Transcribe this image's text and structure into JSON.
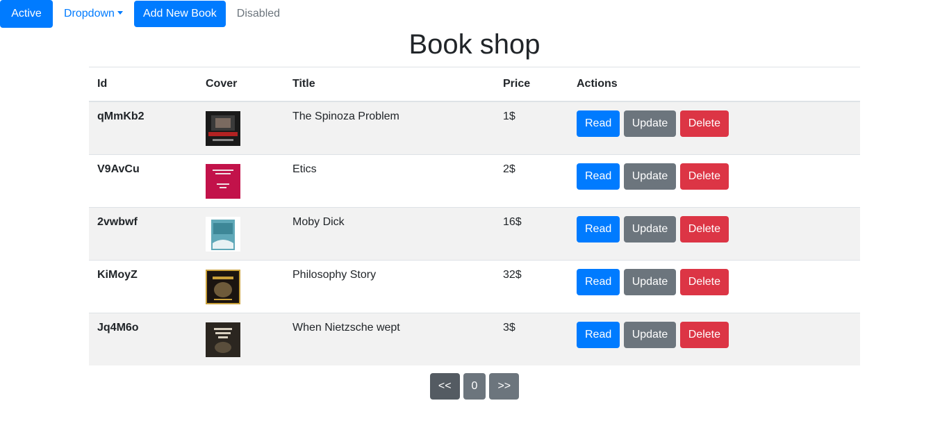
{
  "nav": {
    "active_label": "Active",
    "dropdown_label": "Dropdown",
    "add_label": "Add New Book",
    "disabled_label": "Disabled"
  },
  "page": {
    "title": "Book shop"
  },
  "table": {
    "headers": {
      "id": "Id",
      "cover": "Cover",
      "title": "Title",
      "price": "Price",
      "actions": "Actions"
    },
    "rows": [
      {
        "id": "qMmKb2",
        "title": "The Spinoza Problem",
        "price": "1$",
        "cover_colors": [
          "#1a1a1a",
          "#b22222"
        ]
      },
      {
        "id": "V9AvCu",
        "title": "Etics",
        "price": "2$",
        "cover_colors": [
          "#c2124a",
          "#e8e0e0"
        ]
      },
      {
        "id": "2vwbwf",
        "title": "Moby Dick",
        "price": "16$",
        "cover_colors": [
          "#5fa8b8",
          "#ffffff"
        ]
      },
      {
        "id": "KiMoyZ",
        "title": "Philosophy Story",
        "price": "32$",
        "cover_colors": [
          "#1b1410",
          "#c9a03a"
        ]
      },
      {
        "id": "Jq4M6o",
        "title": "When Nietzsche wept",
        "price": "3$",
        "cover_colors": [
          "#2b2620",
          "#8a7a60"
        ]
      }
    ],
    "row_actions": {
      "read": "Read",
      "update": "Update",
      "delete": "Delete"
    }
  },
  "pager": {
    "prev": "<<",
    "page": "0",
    "next": ">>"
  },
  "colors": {
    "primary": "#007bff",
    "secondary": "#6c757d",
    "danger": "#dc3545",
    "stripe": "#f2f2f2"
  }
}
